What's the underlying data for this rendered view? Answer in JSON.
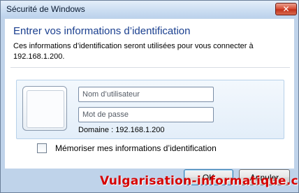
{
  "window": {
    "title": "Sécurité de Windows",
    "close_glyph": "✕"
  },
  "header": {
    "title": "Entrer vos informations d’identification",
    "subtitle": "Ces informations d’identification seront utilisées pour vous connecter à 192.168.1.200."
  },
  "credentials": {
    "username": {
      "value": "",
      "placeholder": "Nom d’utilisateur"
    },
    "password": {
      "value": "",
      "placeholder": "Mot de passe"
    },
    "domain_text": "Domaine : 192.168.1.200",
    "avatar_icon": "user-tile-icon"
  },
  "remember": {
    "label": "Mémoriser mes informations d’identification",
    "checked": false
  },
  "buttons": {
    "ok_label": "OK",
    "cancel_label": "Annuler"
  },
  "watermark": {
    "text": "Vulgarisation-informatique.com"
  },
  "colors": {
    "title_blue": "#1a3f8f",
    "watermark_red": "#d50000",
    "frame": "#bfd3ea"
  }
}
